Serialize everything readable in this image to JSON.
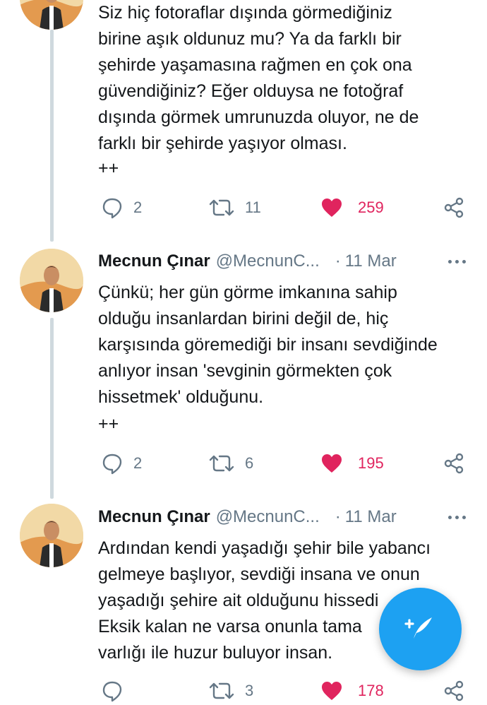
{
  "tweets": [
    {
      "author": "",
      "handle": "",
      "date": "",
      "text": "Siz hiç fotoraflar dışında görmediğiniz\nbirine aşık oldunuz mu? Ya da farklı bir\nşehirde yaşamasına rağmen en çok ona\ngüvendiğiniz? Eğer olduysa ne fotoğraf\ndışında görmek umrunuzda oluyor, ne de\nfarklı bir şehirde yaşıyor olması.",
      "suffix": "++",
      "replies": "2",
      "retweets": "11",
      "likes": "259"
    },
    {
      "author": "Mecnun Çınar",
      "handle": "@MecnunC...",
      "date": "11 Mar",
      "text": "Çünkü; her gün görme imkanına sahip\nolduğu insanlardan birini değil de, hiç\nkarşısında göremediği bir insanı sevdiğinde\nanlıyor insan 'sevginin görmekten çok\nhissetmek' olduğunu.",
      "suffix": "++",
      "replies": "2",
      "retweets": "6",
      "likes": "195"
    },
    {
      "author": "Mecnun Çınar",
      "handle": "@MecnunC...",
      "date": "11 Mar",
      "text": "Ardından kendi yaşadığı şehir bile yabancı\ngelmeye başlıyor, sevdiği insana ve onun\nyaşadığı şehire ait olduğunu hissedi\nEksik kalan ne varsa onunla tama\nvarlığı ile huzur buluyor insan.",
      "suffix": "",
      "replies": "",
      "retweets": "3",
      "likes": "178"
    }
  ],
  "icons": {
    "reply": "reply-icon",
    "retweet": "retweet-icon",
    "like": "heart-icon",
    "share": "share-icon",
    "more": "more-options-icon",
    "compose": "compose-tweet-icon"
  },
  "colors": {
    "accent": "#1da1f2",
    "like": "#e0245e",
    "secondary_text": "#657786",
    "thread_line": "#cfd9de"
  }
}
